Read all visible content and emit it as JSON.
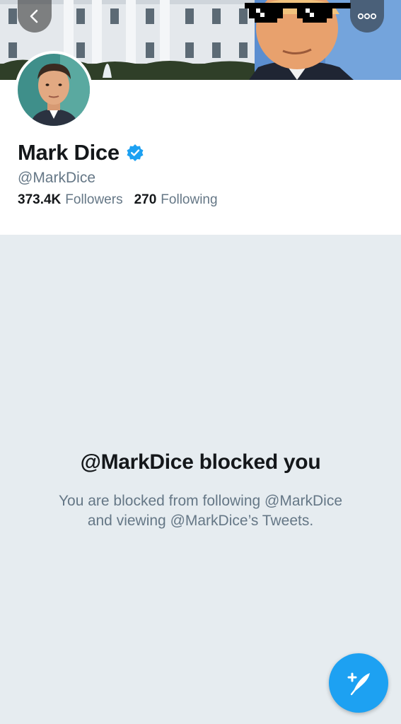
{
  "profile": {
    "display_name": "Mark Dice",
    "handle": "@MarkDice",
    "verified": true,
    "followers": {
      "count": "373.4K",
      "label": "Followers"
    },
    "following": {
      "count": "270",
      "label": "Following"
    }
  },
  "header": {
    "back_icon": "chevron-left-icon",
    "more_icon": "more-horizontal-icon"
  },
  "blocked": {
    "title": "@MarkDice blocked you",
    "description_line1": "You are blocked from following @MarkDice",
    "description_line2": "and viewing @MarkDice’s Tweets."
  },
  "compose": {
    "icon": "compose-tweet-icon"
  },
  "colors": {
    "accent": "#1da1f2",
    "text_primary": "#14171a",
    "text_secondary": "#657786",
    "panel_background": "#e6ecf0"
  }
}
